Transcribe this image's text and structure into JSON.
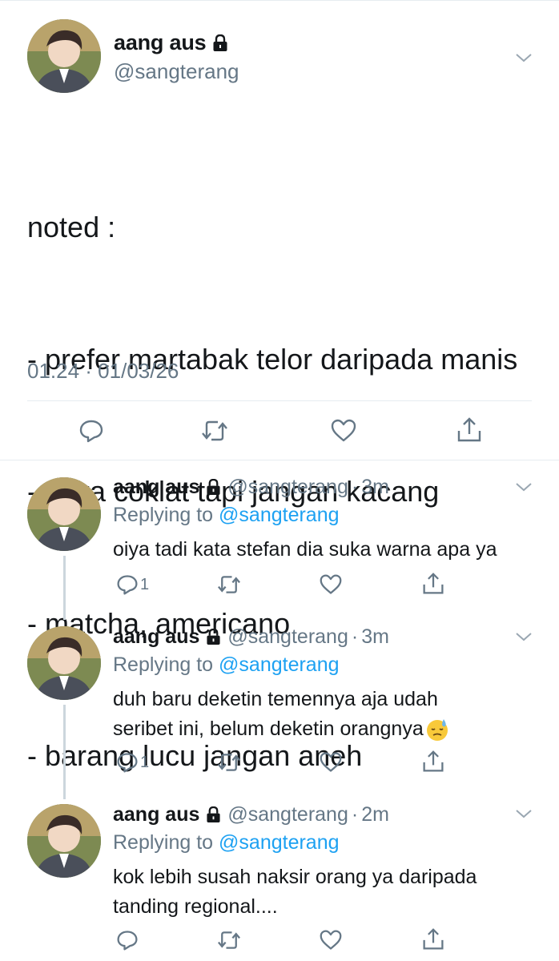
{
  "main_tweet": {
    "display_name": "aang aus",
    "handle": "@sangterang",
    "text_lines": [
      "noted :",
      "- prefer martabak telor daripada manis",
      "- suka coklat tapi jangan kacang",
      "- matcha, americano",
      "- barang lucu jangan aneh"
    ],
    "timestamp": "01.24 · 01/03/26"
  },
  "replies": [
    {
      "display_name": "aang aus",
      "handle": "@sangterang",
      "dot": "·",
      "time": "3m",
      "replying_prefix": "Replying to ",
      "replying_to": "@sangterang",
      "text": "oiya tadi kata stefan dia suka warna apa ya",
      "reply_count": "1"
    },
    {
      "display_name": "aang aus",
      "handle": "@sangterang",
      "dot": "·",
      "time": "3m",
      "replying_prefix": "Replying to ",
      "replying_to": "@sangterang",
      "text": "duh baru deketin temennya aja udah seribet ini, belum deketin orangnya",
      "emoji": "downcast-face-with-sweat",
      "reply_count": "1"
    },
    {
      "display_name": "aang aus",
      "handle": "@sangterang",
      "dot": "·",
      "time": "2m",
      "replying_prefix": "Replying to ",
      "replying_to": "@sangterang",
      "text": "kok lebih susah naksir orang ya daripada tanding regional....",
      "reply_count": ""
    }
  ],
  "icons": {
    "lock": "lock-icon",
    "more": "chevron-down-icon",
    "reply": "reply-icon",
    "retweet": "retweet-icon",
    "like": "heart-icon",
    "share": "share-icon"
  },
  "colors": {
    "link": "#1da1f2",
    "secondary_text": "#657786",
    "primary_text": "#14171a",
    "divider": "#e6ecf0",
    "thread_line": "#ccd6dd"
  }
}
